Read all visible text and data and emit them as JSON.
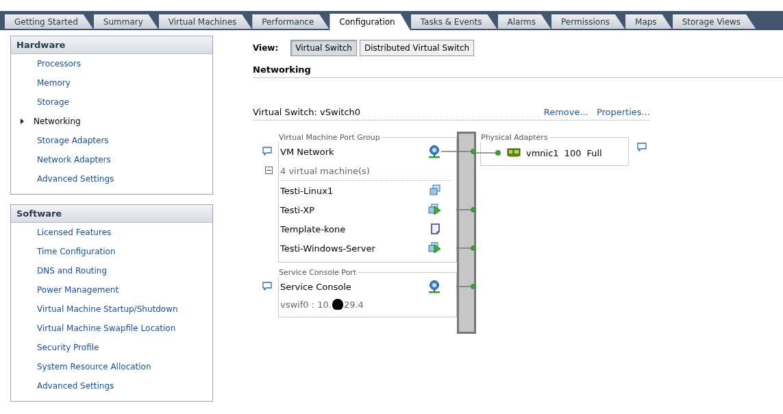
{
  "tabs": [
    {
      "label": "Getting Started",
      "selected": false
    },
    {
      "label": "Summary",
      "selected": false
    },
    {
      "label": "Virtual Machines",
      "selected": false
    },
    {
      "label": "Performance",
      "selected": false
    },
    {
      "label": "Configuration",
      "selected": true
    },
    {
      "label": "Tasks & Events",
      "selected": false
    },
    {
      "label": "Alarms",
      "selected": false
    },
    {
      "label": "Permissions",
      "selected": false
    },
    {
      "label": "Maps",
      "selected": false
    },
    {
      "label": "Storage Views",
      "selected": false
    }
  ],
  "sidebar": [
    {
      "title": "Hardware",
      "items": [
        {
          "label": "Processors",
          "selected": false
        },
        {
          "label": "Memory",
          "selected": false
        },
        {
          "label": "Storage",
          "selected": false
        },
        {
          "label": "Networking",
          "selected": true
        },
        {
          "label": "Storage Adapters",
          "selected": false
        },
        {
          "label": "Network Adapters",
          "selected": false
        },
        {
          "label": "Advanced Settings",
          "selected": false
        }
      ]
    },
    {
      "title": "Software",
      "items": [
        {
          "label": "Licensed Features",
          "selected": false
        },
        {
          "label": "Time Configuration",
          "selected": false
        },
        {
          "label": "DNS and Routing",
          "selected": false
        },
        {
          "label": "Power Management",
          "selected": false
        },
        {
          "label": "Virtual Machine Startup/Shutdown",
          "selected": false
        },
        {
          "label": "Virtual Machine Swapfile Location",
          "selected": false
        },
        {
          "label": "Security Profile",
          "selected": false
        },
        {
          "label": "System Resource Allocation",
          "selected": false
        },
        {
          "label": "Advanced Settings",
          "selected": false
        }
      ]
    }
  ],
  "view": {
    "label": "View:",
    "options": [
      {
        "label": "Virtual Switch",
        "selected": true
      },
      {
        "label": "Distributed Virtual Switch",
        "selected": false
      }
    ]
  },
  "section_title": "Networking",
  "vswitch": {
    "title": "Virtual Switch: vSwitch0",
    "actions": [
      "Remove...",
      "Properties..."
    ],
    "port_groups": [
      {
        "kind": "vm",
        "legend": "Virtual Machine Port Group",
        "name": "VM Network",
        "expanded": true,
        "summary": "4 virtual machine(s)",
        "vms": [
          {
            "name": "Testi-Linux1",
            "kind": "off",
            "connected": false
          },
          {
            "name": "Testi-XP",
            "kind": "running",
            "connected": true
          },
          {
            "name": "Template-kone",
            "kind": "template",
            "connected": false
          },
          {
            "name": "Testi-Windows-Server",
            "kind": "running",
            "connected": true
          }
        ]
      },
      {
        "kind": "console",
        "legend": "Service Console Port",
        "name": "Service Console",
        "detail_start": "vswif0 : 10.",
        "detail_end": "29.4"
      }
    ],
    "physical": {
      "legend": "Physical Adapters",
      "adapters": [
        {
          "name": "vmnic1",
          "speed": "100",
          "duplex": "Full"
        }
      ]
    }
  }
}
